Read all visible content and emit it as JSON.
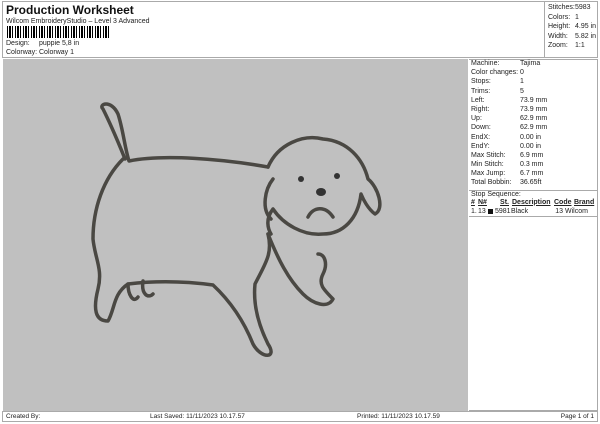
{
  "header": {
    "title": "Production Worksheet",
    "subtitle": "Wilcom EmbroideryStudio – Level 3 Advanced",
    "design_label": "Design:",
    "design": "puppie 5,8 in",
    "colorway_label": "Colorway:",
    "colorway": "Colorway 1"
  },
  "stats": [
    {
      "label": "Stitches:",
      "value": "5983"
    },
    {
      "label": "Colors:",
      "value": "1"
    },
    {
      "label": "Height:",
      "value": "4.95 in"
    },
    {
      "label": "Width:",
      "value": "5.82 in"
    },
    {
      "label": "Zoom:",
      "value": "1:1"
    }
  ],
  "info": [
    {
      "label": "Machine:",
      "value": "Tajima"
    },
    {
      "label": "Color changes:",
      "value": "0"
    },
    {
      "label": "Stops:",
      "value": "1"
    },
    {
      "label": "Trims:",
      "value": "5"
    },
    {
      "label": "Left:",
      "value": "73.9 mm"
    },
    {
      "label": "Right:",
      "value": "73.9 mm"
    },
    {
      "label": "Up:",
      "value": "62.9 mm"
    },
    {
      "label": "Down:",
      "value": "62.9 mm"
    },
    {
      "label": "EndX:",
      "value": "0.00 in"
    },
    {
      "label": "EndY:",
      "value": "0.00 in"
    },
    {
      "label": "Max Stitch:",
      "value": "6.9 mm"
    },
    {
      "label": "Min Stitch:",
      "value": "0.3 mm"
    },
    {
      "label": "Max Jump:",
      "value": "6.7 mm"
    },
    {
      "label": "Total Bobbin:",
      "value": "36.65ft"
    }
  ],
  "stop_sequence": {
    "title": "Stop Sequence:",
    "headers": [
      "#",
      "N#",
      "St.",
      "Description",
      "Code",
      "Brand"
    ],
    "rows": [
      {
        "num": "1.",
        "n": "13",
        "color": "#111111",
        "st": "5981",
        "desc": "Black",
        "code": "13",
        "brand": "Wilcom"
      }
    ]
  },
  "footer": {
    "created": "Created By:",
    "saved": "Last Saved: 11/11/2023 10.17.57",
    "printed": "Printed: 11/11/2023 10.17.59",
    "page": "Page 1 of 1"
  }
}
